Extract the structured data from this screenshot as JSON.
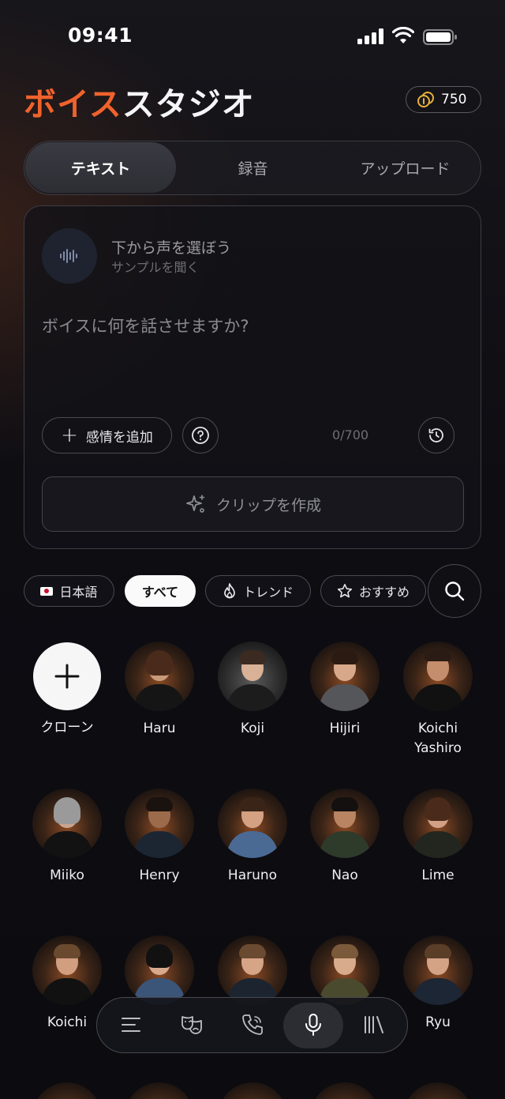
{
  "status": {
    "time": "09:41"
  },
  "header": {
    "title_accent": "ボイス",
    "title_rest": "スタジオ",
    "credits": "750"
  },
  "tabs": [
    {
      "label": "テキスト",
      "active": true
    },
    {
      "label": "録音"
    },
    {
      "label": "アップロード"
    }
  ],
  "composer": {
    "voice_title": "下から声を選ぼう",
    "voice_subtitle": "サンプルを聞く",
    "placeholder": "ボイスに何を話させますか?",
    "emotion_label": "感情を追加",
    "counter": "0/700",
    "create_label": "クリップを作成"
  },
  "filters": {
    "language": "日本語",
    "all": "すべて",
    "trending": "トレンド",
    "recommended": "おすすめ"
  },
  "voices": [
    {
      "name": "クローン"
    },
    {
      "name": "Haru"
    },
    {
      "name": "Koji"
    },
    {
      "name": "Hijiri"
    },
    {
      "name": "Koichi Yashiro"
    },
    {
      "name": "Miiko"
    },
    {
      "name": "Henry"
    },
    {
      "name": "Haruno"
    },
    {
      "name": "Nao"
    },
    {
      "name": "Lime"
    },
    {
      "name": "Koichi"
    },
    {
      "name": "Ryu"
    }
  ],
  "colors": {
    "accent": "#f0622c",
    "background": "#0d0d12"
  },
  "nav": [
    "menu-icon",
    "masks-icon",
    "phone-icon",
    "microphone-icon",
    "library-icon"
  ]
}
